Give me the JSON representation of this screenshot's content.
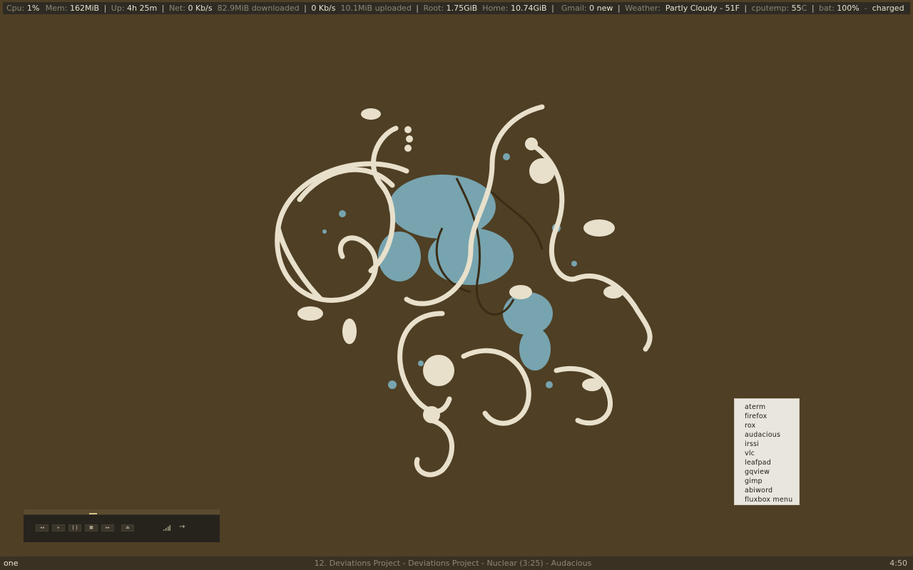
{
  "topbar": {
    "cpu_label": "Cpu:",
    "cpu_value": "1%",
    "mem_label": "Mem:",
    "mem_value": "162MiB",
    "up_label": "Up:",
    "up_value": "4h 25m",
    "net_label": "Net:",
    "net_down": "0 Kb/s",
    "downloaded": "82.9MiB downloaded",
    "net_up": "0 Kb/s",
    "uploaded": "10.1MiB uploaded",
    "root_label": "Root:",
    "root_value": "1.75GiB",
    "home_label": "Home:",
    "home_value": "10.74GiB",
    "gmail_label": "Gmail:",
    "gmail_value": "0 new",
    "weather_label": "Weather:",
    "weather_value": "Partly Cloudy - 51F",
    "cputemp_label": "cputemp:",
    "cputemp_value": "55",
    "cputemp_unit": "C",
    "bat_label": "bat:",
    "bat_value": "100%",
    "bat_status": "charged",
    "separator": "|",
    "dash": "-"
  },
  "menu": {
    "items": [
      "aterm",
      "firefox",
      "rox",
      "audacious",
      "irssi",
      "vlc",
      "leafpad",
      "gqview",
      "gimp",
      "abiword",
      "fluxbox menu"
    ]
  },
  "player": {
    "buttons": [
      {
        "name": "previous-button",
        "glyph": "◂◂"
      },
      {
        "name": "play-button",
        "glyph": "▸"
      },
      {
        "name": "pause-button",
        "glyph": "❙❙"
      },
      {
        "name": "stop-button",
        "glyph": "■"
      },
      {
        "name": "next-button",
        "glyph": "▸▸"
      },
      {
        "name": "eject-button",
        "glyph": "⏏"
      }
    ],
    "arrow_glyph": "→",
    "seek_position": 0.35
  },
  "taskbar": {
    "workspace": "one",
    "window_title": "12. Deviations Project - Deviations Project - Nuclear (3:25) - Audacious",
    "clock": "4:50"
  },
  "colors": {
    "desktop": "#4f3f24",
    "ornament": "#e8e0cb",
    "splash": "#7fb6c8"
  }
}
